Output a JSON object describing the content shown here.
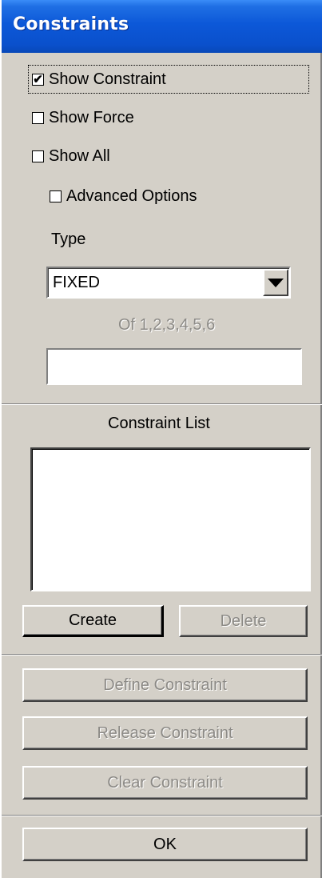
{
  "window": {
    "title": "Constraints"
  },
  "checkboxes": {
    "show_constraint": {
      "label": "Show Constraint",
      "checked": true,
      "mark": "✔"
    },
    "show_force": {
      "label": "Show Force",
      "checked": false
    },
    "show_all": {
      "label": "Show All",
      "checked": false
    },
    "advanced_options": {
      "label": "Advanced Options",
      "checked": false
    }
  },
  "type_section": {
    "label": "Type",
    "selected": "FIXED",
    "dof_text": "Of 1,2,3,4,5,6",
    "input_value": ""
  },
  "constraint_list": {
    "label": "Constraint List",
    "items": []
  },
  "buttons": {
    "create": "Create",
    "delete": "Delete",
    "define_constraint": "Define Constraint",
    "release_constraint": "Release Constraint",
    "clear_constraint": "Clear Constraint",
    "ok": "OK"
  }
}
